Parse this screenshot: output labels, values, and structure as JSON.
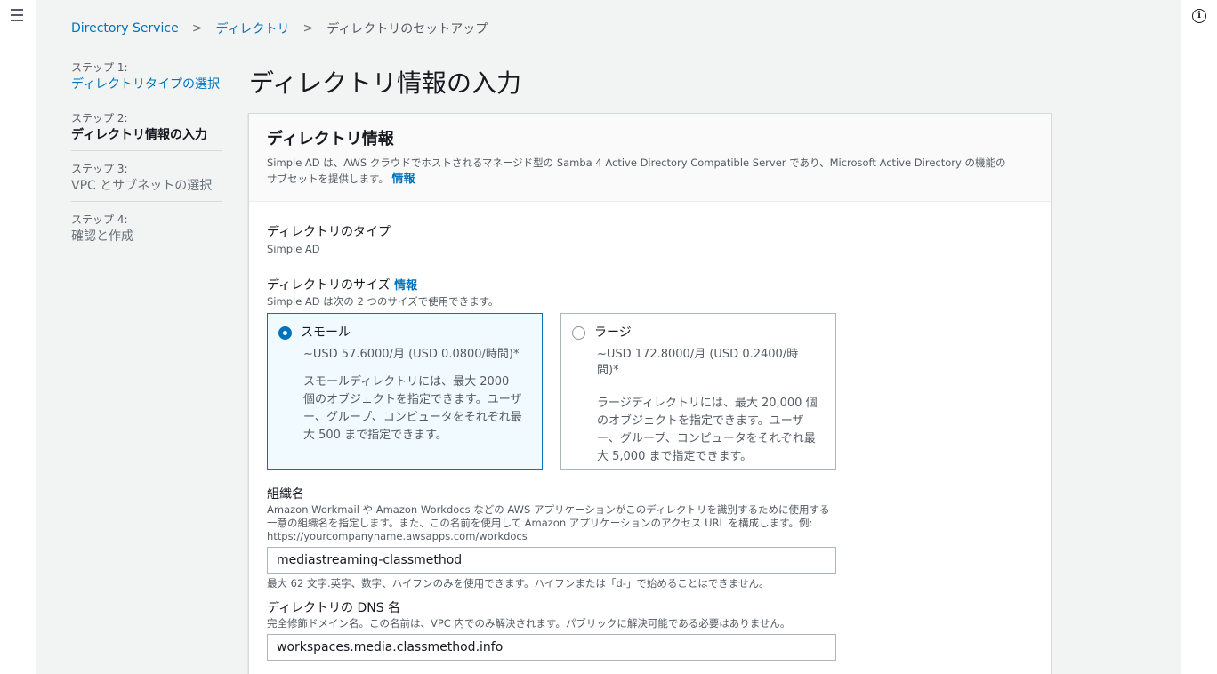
{
  "breadcrumb": {
    "items": [
      "Directory Service",
      "ディレクトリ",
      "ディレクトリのセットアップ"
    ]
  },
  "steps": [
    {
      "num": "ステップ 1:",
      "name": "ディレクトリタイプの選択"
    },
    {
      "num": "ステップ 2:",
      "name": "ディレクトリ情報の入力"
    },
    {
      "num": "ステップ 3:",
      "name": "VPC とサブネットの選択"
    },
    {
      "num": "ステップ 4:",
      "name": "確認と作成"
    }
  ],
  "page_title": "ディレクトリ情報の入力",
  "panel": {
    "title": "ディレクトリ情報",
    "description": "Simple AD は、AWS クラウドでホストされるマネージド型の Samba 4 Active Directory Compatible Server であり、Microsoft Active Directory の機能のサブセットを提供します。",
    "info_link": "情報"
  },
  "directory_type": {
    "label": "ディレクトリのタイプ",
    "value": "Simple AD"
  },
  "directory_size": {
    "label": "ディレクトリのサイズ",
    "info_link": "情報",
    "description": "Simple AD は次の 2 つのサイズで使用できます。",
    "options": [
      {
        "title": "スモール",
        "price": "~USD 57.6000/月 (USD 0.0800/時間)*",
        "description": "スモールディレクトリには、最大 2000 個のオブジェクトを指定できます。ユーザー、グループ、コンピュータをそれぞれ最大 500 まで指定できます。",
        "selected": true
      },
      {
        "title": "ラージ",
        "price": "~USD 172.8000/月 (USD 0.2400/時間)*",
        "description": "ラージディレクトリには、最大 20,000 個のオブジェクトを指定できます。ユーザー、グループ、コンピュータをそれぞれ最大 5,000 まで指定できます。",
        "selected": false
      }
    ]
  },
  "org_name": {
    "label": "組織名",
    "description": "Amazon Workmail や Amazon Workdocs などの AWS アプリケーションがこのディレクトリを識別するために使用する一意の組織名を指定します。また、この名前を使用して Amazon アプリケーションのアクセス URL を構成します。例: https://yourcompanyname.awsapps.com/workdocs",
    "value": "mediastreaming-classmethod",
    "constraint": "最大 62 文字.英字、数字、ハイフンのみを使用できます。ハイフンまたは「d-」で始めることはできません。"
  },
  "dns_name": {
    "label": "ディレクトリの DNS 名",
    "description": "完全修飾ドメイン名。この名前は、VPC 内でのみ解決されます。パブリックに解決可能である必要はありません。",
    "value": "workspaces.media.classmethod.info"
  }
}
